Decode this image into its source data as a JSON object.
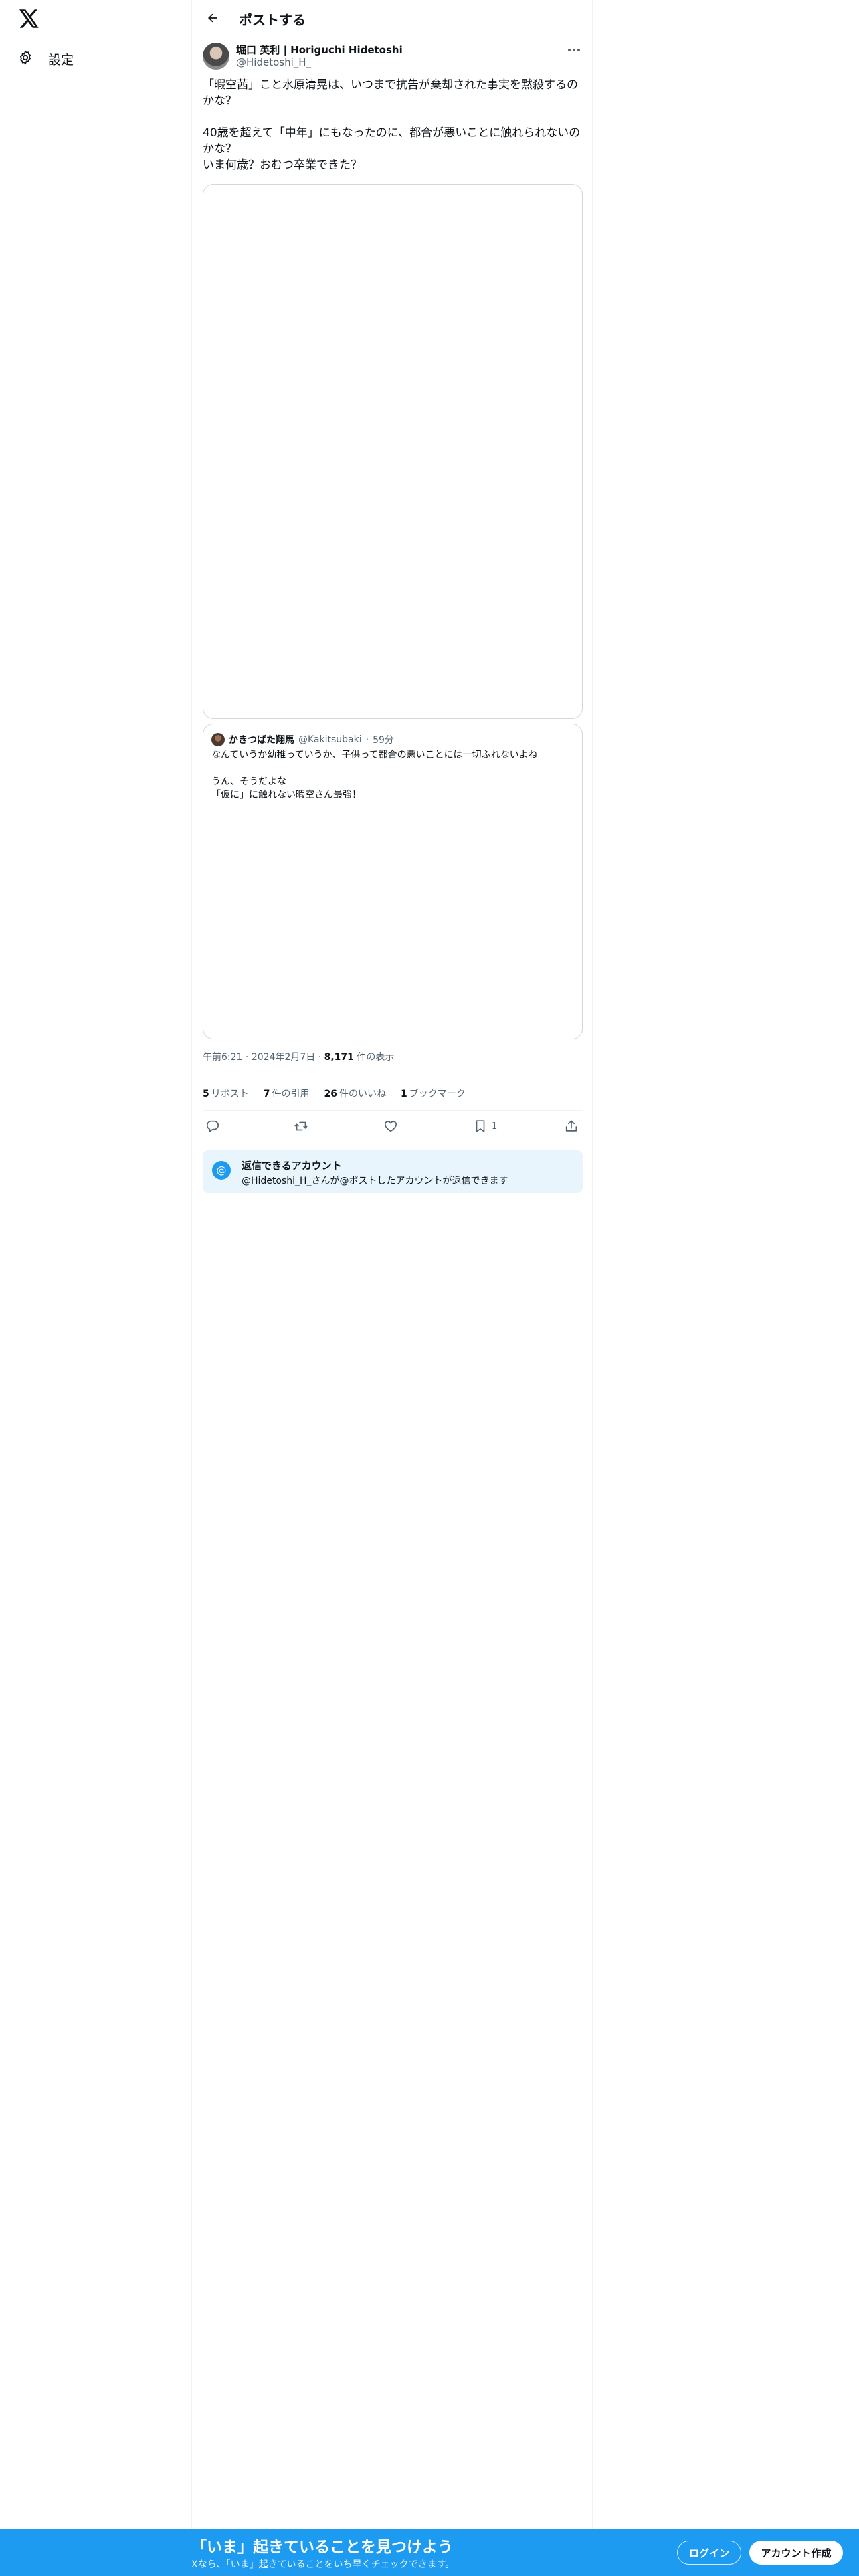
{
  "app": {
    "page_title": "ポストする"
  },
  "sidebar": {
    "settings_label": "設定"
  },
  "post": {
    "author_name": "堀口 英利 | Horiguchi Hidetoshi",
    "author_handle": "@Hidetoshi_H_",
    "text": "「暇空茜」こと水原清晃は、いつまで抗告が棄却された事実を黙殺するのかな？\n\n40歳を超えて「中年」にもなったのに、都合が悪いことに触れられないのかな？\nいま何歳？おむつ卒業できた？",
    "time": "午前6:21",
    "date": "2024年2月7日",
    "views_count": "8,171",
    "views_label": "件の表示",
    "separator": "·"
  },
  "quote": {
    "author_name": "かきつばた翔馬",
    "author_handle": "@Kakitsubaki",
    "time_ago": "59分",
    "text": "なんていうか幼稚っていうか、子供って都合の悪いことには一切ふれないよね\n\nうん、そうだよな\n「仮に」に触れない暇空さん最強！"
  },
  "stats": {
    "reposts_count": "5",
    "reposts_label": "リポスト",
    "quotes_count": "7",
    "quotes_label": "件の引用",
    "likes_count": "26",
    "likes_label": "件のいいね",
    "bookmarks_count": "1",
    "bookmarks_label": "ブックマーク"
  },
  "actions": {
    "bookmark_count": "1"
  },
  "reply_restriction": {
    "title": "返信できるアカウント",
    "subtitle": "@Hidetoshi_H_さんが@ポストしたアカウントが返信できます"
  },
  "banner": {
    "title": "「いま」起きていることを見つけよう",
    "subtitle": "Xなら、「いま」起きていることをいち早くチェックできます。",
    "login_label": "ログイン",
    "signup_label": "アカウント作成"
  },
  "colors": {
    "accent": "#1d9bf0",
    "text": "#0f1419",
    "muted": "#536471",
    "border": "#cfd9de",
    "reply_bg": "#e8f5fd"
  },
  "icons": [
    "x-logo-icon",
    "gear-icon",
    "back-arrow-icon",
    "more-icon",
    "reply-icon",
    "repost-icon",
    "like-icon",
    "bookmark-icon",
    "share-icon",
    "at-sign-icon"
  ]
}
